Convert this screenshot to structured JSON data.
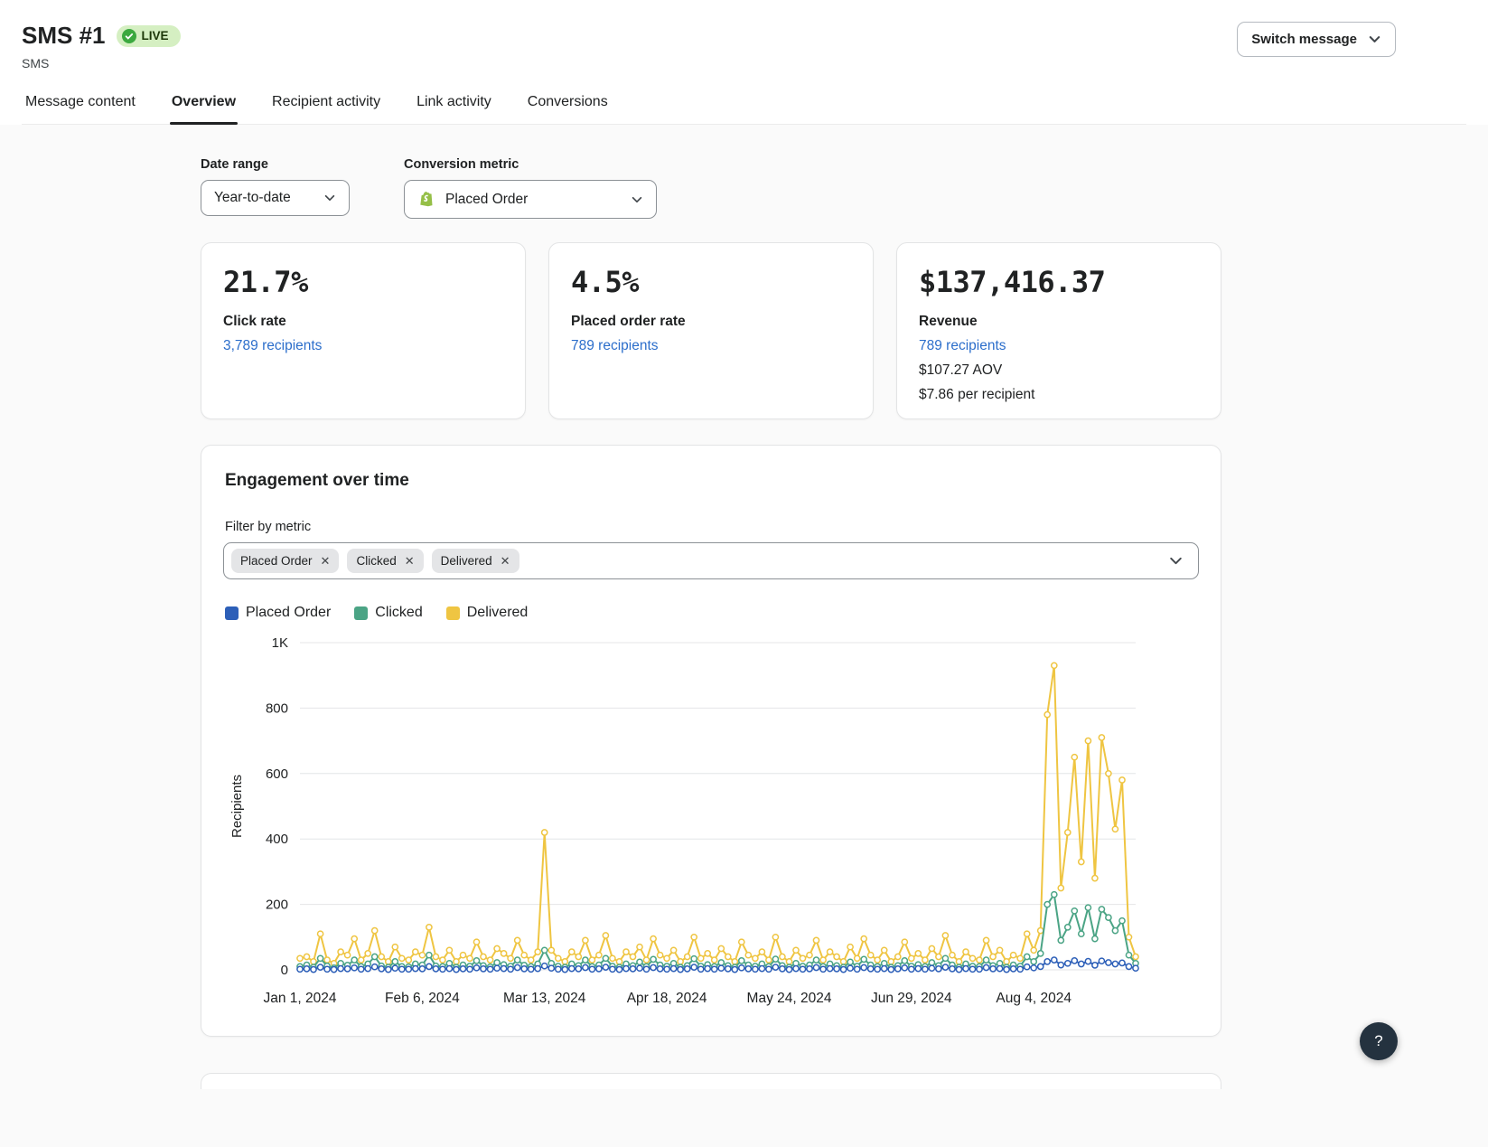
{
  "header": {
    "title": "SMS #1",
    "status": "LIVE",
    "subtitle": "SMS",
    "switch_button": "Switch message"
  },
  "tabs": [
    "Message content",
    "Overview",
    "Recipient activity",
    "Link activity",
    "Conversions"
  ],
  "filters": {
    "date_range_label": "Date range",
    "date_range_value": "Year-to-date",
    "conversion_metric_label": "Conversion metric",
    "conversion_metric_value": "Placed Order"
  },
  "metrics": [
    {
      "value": "21.7%",
      "label": "Click rate",
      "link": "3,789 recipients"
    },
    {
      "value": "4.5%",
      "label": "Placed order rate",
      "link": "789 recipients"
    },
    {
      "value": "$137,416.37",
      "label": "Revenue",
      "link": "789 recipients",
      "aov": "$107.27 AOV",
      "per_recipient": "$7.86 per recipient"
    }
  ],
  "engagement": {
    "title": "Engagement over time",
    "filter_label": "Filter by metric",
    "chips": [
      "Placed Order",
      "Clicked",
      "Delivered"
    ]
  },
  "help_button": "?",
  "colors": {
    "link": "#2c6ecb",
    "live_badge_bg": "#d5efc2",
    "live_badge_icon": "#3ba93f"
  },
  "chart_data": {
    "type": "line",
    "title": "Engagement over time",
    "xlabel": "",
    "ylabel": "Recipients",
    "ylim": [
      0,
      1000
    ],
    "yticks": [
      "0",
      "200",
      "400",
      "600",
      "800",
      "1K"
    ],
    "grid": true,
    "legend_position": "top-left",
    "xticklabels": [
      "Jan 1, 2024",
      "Feb 6, 2024",
      "Mar 13, 2024",
      "Apr 18, 2024",
      "May 24, 2024",
      "Jun 29, 2024",
      "Aug 4, 2024"
    ],
    "xtick_indices": [
      0,
      18,
      36,
      54,
      72,
      90,
      108
    ],
    "series": [
      {
        "name": "Placed Order",
        "color": "#2d5fb8",
        "values": [
          2,
          3,
          1,
          8,
          2,
          1,
          4,
          3,
          6,
          2,
          4,
          9,
          3,
          1,
          5,
          2,
          2,
          4,
          3,
          10,
          3,
          2,
          4,
          1,
          3,
          2,
          6,
          3,
          2,
          5,
          4,
          2,
          7,
          3,
          2,
          4,
          12,
          5,
          2,
          1,
          4,
          3,
          7,
          2,
          3,
          8,
          2,
          1,
          4,
          3,
          5,
          2,
          7,
          3,
          2,
          4,
          1,
          3,
          8,
          2,
          4,
          2,
          5,
          3,
          1,
          6,
          3,
          2,
          4,
          2,
          8,
          3,
          1,
          4,
          2,
          3,
          7,
          2,
          4,
          3,
          1,
          5,
          2,
          7,
          3,
          2,
          4,
          1,
          3,
          6,
          2,
          4,
          2,
          5,
          3,
          8,
          3,
          1,
          4,
          2,
          2,
          7,
          3,
          4,
          1,
          3,
          2,
          9,
          6,
          10,
          25,
          30,
          15,
          20,
          28,
          18,
          26,
          14,
          27,
          22,
          18,
          21,
          10,
          5
        ]
      },
      {
        "name": "Clicked",
        "color": "#4ba485",
        "values": [
          10,
          15,
          8,
          35,
          12,
          6,
          20,
          14,
          30,
          10,
          18,
          40,
          12,
          8,
          25,
          10,
          9,
          18,
          15,
          45,
          12,
          10,
          20,
          8,
          15,
          11,
          28,
          13,
          9,
          22,
          16,
          11,
          30,
          14,
          10,
          18,
          60,
          20,
          11,
          8,
          18,
          13,
          30,
          10,
          15,
          35,
          11,
          8,
          18,
          13,
          24,
          10,
          32,
          15,
          11,
          20,
          8,
          13,
          34,
          11,
          16,
          10,
          22,
          13,
          8,
          28,
          15,
          11,
          18,
          10,
          33,
          13,
          8,
          20,
          11,
          15,
          30,
          10,
          18,
          13,
          8,
          24,
          11,
          32,
          15,
          10,
          20,
          8,
          13,
          28,
          11,
          16,
          10,
          22,
          13,
          35,
          15,
          8,
          18,
          11,
          10,
          30,
          13,
          20,
          8,
          15,
          11,
          40,
          25,
          50,
          200,
          230,
          90,
          130,
          180,
          110,
          190,
          95,
          185,
          160,
          120,
          150,
          45,
          20
        ]
      },
      {
        "name": "Delivered",
        "color": "#efc542",
        "values": [
          35,
          40,
          25,
          110,
          30,
          20,
          55,
          45,
          95,
          30,
          50,
          120,
          40,
          25,
          70,
          35,
          30,
          55,
          45,
          130,
          40,
          30,
          60,
          25,
          45,
          35,
          85,
          40,
          30,
          65,
          50,
          35,
          90,
          45,
          30,
          55,
          420,
          60,
          35,
          25,
          55,
          40,
          90,
          30,
          45,
          105,
          35,
          25,
          55,
          40,
          70,
          30,
          95,
          45,
          35,
          60,
          25,
          40,
          100,
          35,
          50,
          30,
          65,
          40,
          25,
          85,
          45,
          35,
          55,
          30,
          100,
          40,
          25,
          60,
          35,
          45,
          90,
          30,
          55,
          40,
          25,
          70,
          35,
          95,
          45,
          30,
          60,
          25,
          40,
          85,
          35,
          50,
          30,
          65,
          40,
          105,
          45,
          25,
          55,
          35,
          30,
          90,
          40,
          60,
          25,
          45,
          35,
          110,
          60,
          120,
          780,
          930,
          250,
          420,
          650,
          330,
          700,
          280,
          710,
          600,
          430,
          580,
          100,
          40
        ]
      }
    ]
  }
}
